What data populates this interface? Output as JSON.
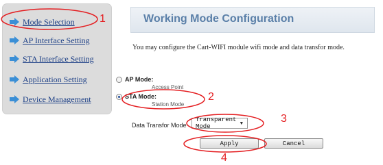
{
  "sidebar": {
    "items": [
      {
        "label": "Mode Selection"
      },
      {
        "label": "AP Interface Setting"
      },
      {
        "label": "STA Interface Setting"
      },
      {
        "label": "Application Setting"
      },
      {
        "label": "Device Management"
      }
    ]
  },
  "main": {
    "title": "Working Mode Configuration",
    "description": "You may configure the Cart-WIFI module wifi mode and data transfor mode.",
    "modes": [
      {
        "label": "AP Mode:",
        "sub": "Access Point",
        "checked": false
      },
      {
        "label": "STA Mode:",
        "sub": "Station Mode",
        "checked": true
      }
    ],
    "data_mode_label": "Data Transfor Mode",
    "data_mode_value": "Transparent Mode",
    "apply_label": "Apply",
    "cancel_label": "Cancel"
  },
  "annotations": {
    "color": "#e41f22",
    "numbers": [
      "1",
      "2",
      "3",
      "4"
    ]
  },
  "colors": {
    "link": "#1c3f86",
    "title": "#5a7fa8",
    "arrow": "#3b8fd6"
  }
}
